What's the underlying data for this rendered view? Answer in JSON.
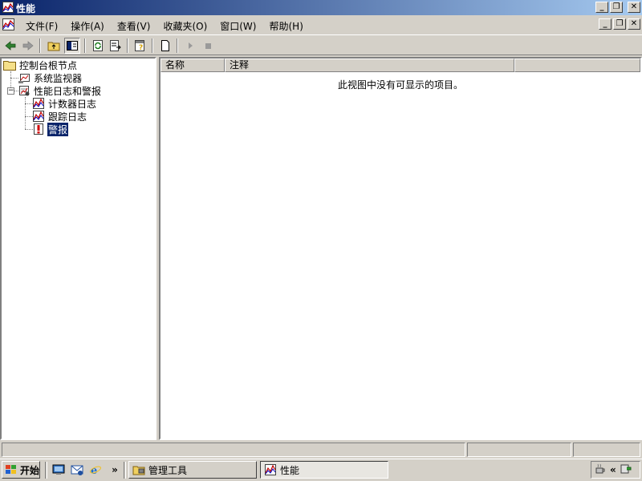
{
  "window": {
    "title": "性能",
    "icon": "performance-chart-icon"
  },
  "menu": {
    "items": [
      "文件(F)",
      "操作(A)",
      "查看(V)",
      "收藏夹(O)",
      "窗口(W)",
      "帮助(H)"
    ]
  },
  "toolbar": {
    "buttons": [
      "back-arrow-icon",
      "forward-arrow-icon",
      "up-folder-icon",
      "show-hide-tree-icon",
      "refresh-icon",
      "export-list-icon",
      "help-icon",
      "new-icon",
      "play-icon",
      "stop-icon"
    ]
  },
  "tree": {
    "root": "控制台根节点",
    "items": [
      {
        "label": "系统监视器",
        "icon": "monitor-chart-icon"
      },
      {
        "label": "性能日志和警报",
        "icon": "logs-icon"
      },
      {
        "label": "计数器日志",
        "icon": "chart-log-icon"
      },
      {
        "label": "跟踪日志",
        "icon": "chart-log-icon"
      },
      {
        "label": "警报",
        "icon": "alert-icon"
      }
    ],
    "selected": "警报"
  },
  "list": {
    "columns": [
      "名称",
      "注释",
      ""
    ],
    "empty_message": "此视图中没有可显示的项目。"
  },
  "taskbar": {
    "start_label": "开始",
    "quick_launch": [
      "desktop-icon",
      "outlook-icon",
      "ie-icon"
    ],
    "chevron": "»",
    "tasks": [
      {
        "label": "管理工具",
        "icon": "admin-tools-icon",
        "active": false
      },
      {
        "label": "性能",
        "icon": "performance-chart-icon",
        "active": true
      }
    ],
    "tray_chevron": "«"
  },
  "colors": {
    "title_active_start": "#0a246a",
    "title_active_end": "#a6caf0",
    "selection": "#0a246a",
    "face": "#d4d0c8"
  }
}
